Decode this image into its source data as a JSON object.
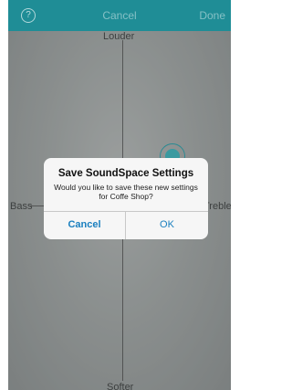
{
  "header": {
    "help_icon": "?",
    "title": "Cancel",
    "done_label": "Done"
  },
  "pad": {
    "top_label": "Louder",
    "bottom_label": "Softer",
    "left_label": "Bass",
    "right_label": "Treble"
  },
  "dialog": {
    "title": "Save SoundSpace Settings",
    "message": "Would you like to save these new settings for Coffe Shop?",
    "cancel_label": "Cancel",
    "ok_label": "OK"
  },
  "colors": {
    "header_bg": "#1f8d96",
    "accent": "#1a7fbf"
  }
}
